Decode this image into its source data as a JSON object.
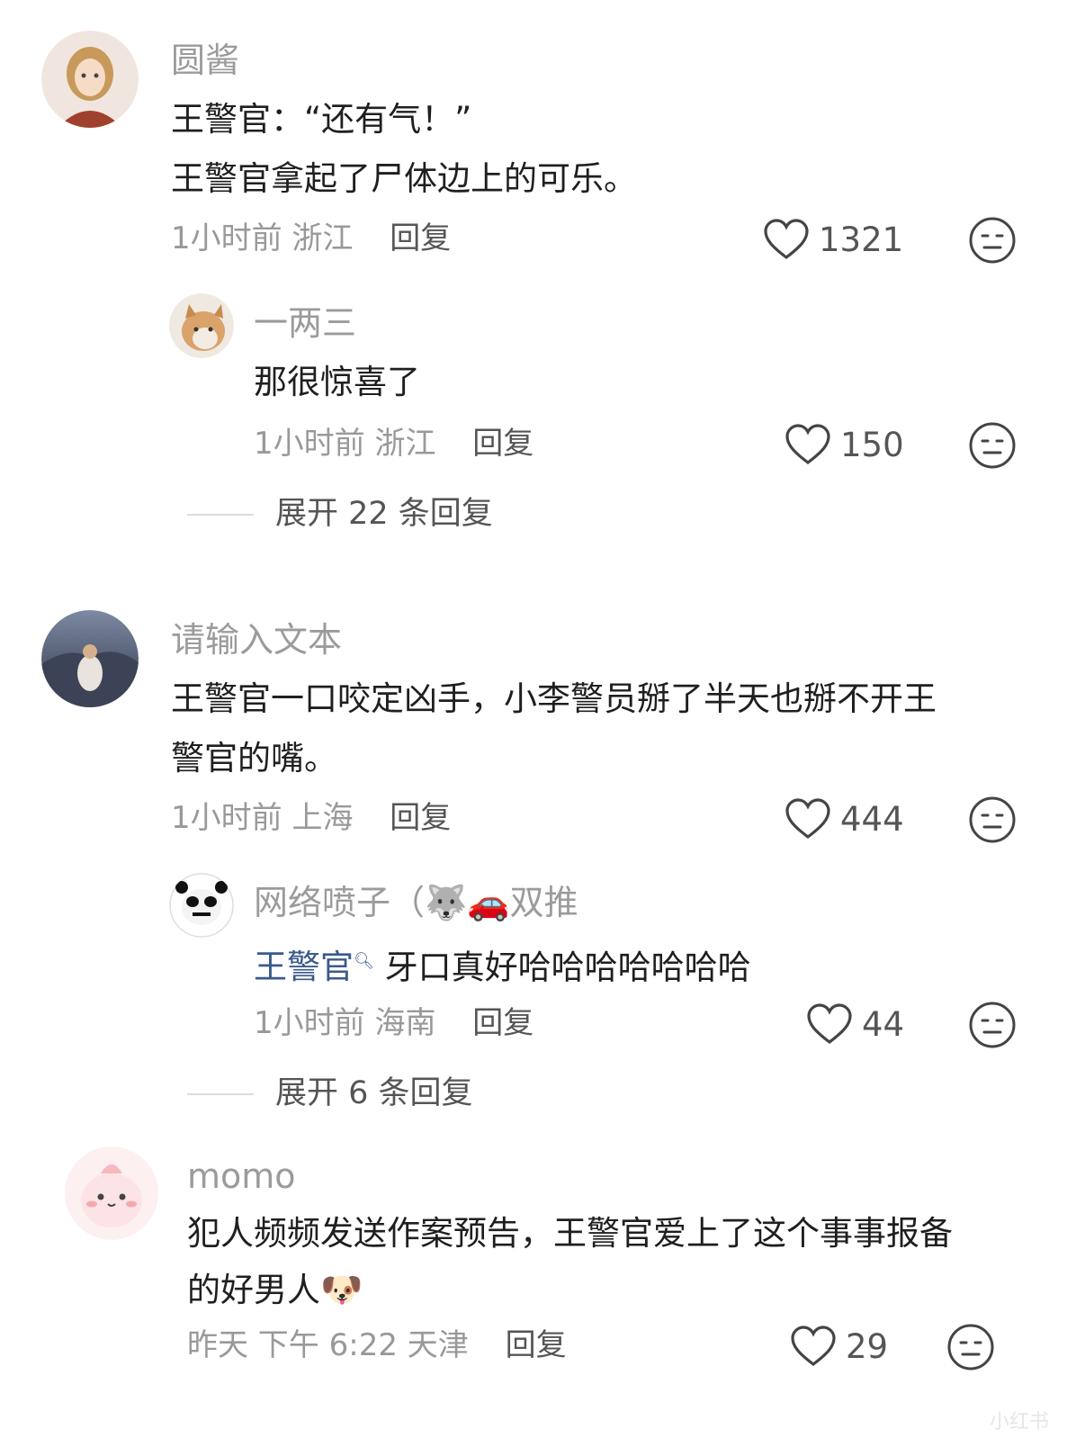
{
  "comments": [
    {
      "username": "圆酱",
      "lines": [
        "王警官：“还有气！”",
        "王警官拿起了尸体边上的可乐。"
      ],
      "time": "1小时前",
      "location": "浙江",
      "reply_label": "回复",
      "likes": "1321",
      "replies": [
        {
          "username": "一两三",
          "text": "那很惊喜了",
          "time": "1小时前",
          "location": "浙江",
          "reply_label": "回复",
          "likes": "150"
        }
      ],
      "expand": "展开 22 条回复"
    },
    {
      "username": "请输入文本",
      "lines": [
        "王警官一口咬定凶手，小李警员掰了半天也掰不开王",
        "警官的嘴。"
      ],
      "time": "1小时前",
      "location": "上海",
      "reply_label": "回复",
      "likes": "444",
      "replies": [
        {
          "username": "网络喷子（",
          "username_suffix": "双推",
          "username_emojis": [
            "🐺",
            "🚗"
          ],
          "mention": "王警官",
          "text": " 牙口真好哈哈哈哈哈哈哈",
          "time": "1小时前",
          "location": "海南",
          "reply_label": "回复",
          "likes": "44"
        }
      ],
      "expand": "展开 6 条回复"
    },
    {
      "username": "momo",
      "lines": [
        "犯人频频发送作案预告，王警官爱上了这个事事报备",
        "的好男人"
      ],
      "line_emoji": "🐶",
      "time": "昨天 下午 6:22",
      "location": "天津",
      "reply_label": "回复",
      "likes": "29"
    }
  ],
  "icons": {
    "like": "heart-outline-icon",
    "dislike": "meh-face-icon"
  },
  "watermark": "小红书"
}
